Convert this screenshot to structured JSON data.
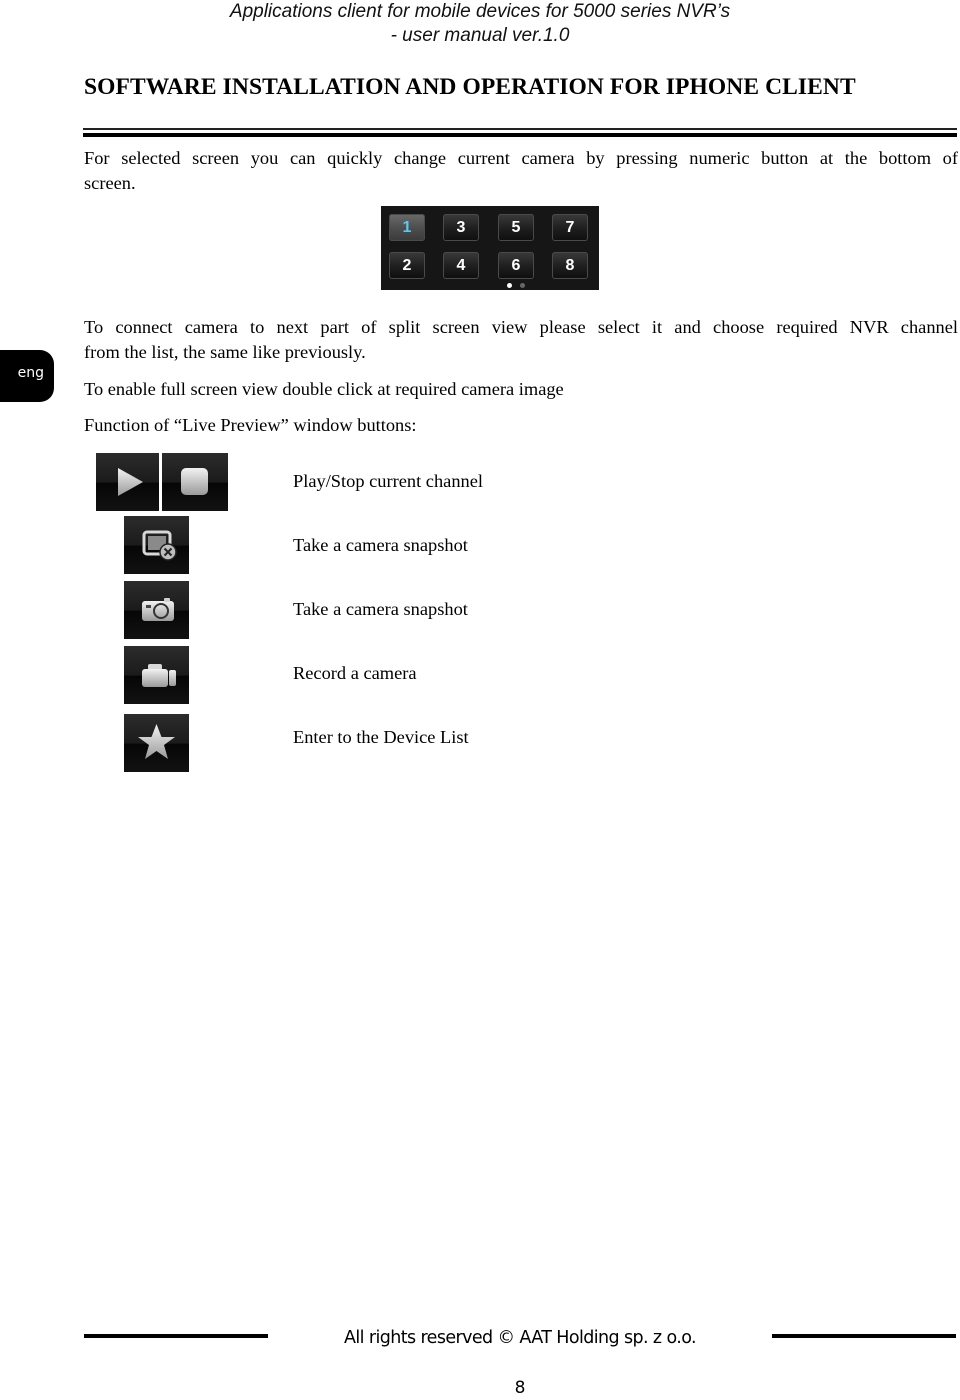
{
  "header": {
    "line1": "Applications client for mobile devices for 5000 series NVR’s",
    "line2": "- user manual ver.1.0"
  },
  "section_title": "SOFTWARE INSTALLATION AND OPERATION FOR IPHONE CLIENT",
  "side_tab": {
    "label": "eng"
  },
  "paragraphs": {
    "p1_line1": "For selected screen you can quickly change current camera by pressing numeric button at the bottom of",
    "p1_line2": "screen.",
    "p2_line1": "To connect camera to next part of split screen view please select it and choose required NVR channel",
    "p2_line2": "from the list, the same like previously.",
    "p3": "To enable full screen view double click at required camera image",
    "p4": "Function of “Live Preview” window buttons:"
  },
  "keypad": {
    "keys": [
      "1",
      "3",
      "5",
      "7",
      "2",
      "4",
      "6",
      "8"
    ],
    "active_key": "1",
    "active_color": "#5cc8f0",
    "page_indicator": {
      "pages": 2,
      "current": 1
    }
  },
  "functions": [
    {
      "icons": [
        "play-icon",
        "stop-icon"
      ],
      "label": "Play/Stop current channel"
    },
    {
      "icons": [
        "close-snapshot-icon"
      ],
      "label": "Take a camera snapshot"
    },
    {
      "icons": [
        "camera-icon"
      ],
      "label": "Take a camera snapshot"
    },
    {
      "icons": [
        "video-camera-icon"
      ],
      "label": "Record a camera"
    },
    {
      "icons": [
        "star-icon"
      ],
      "label": "Enter to the Device List"
    }
  ],
  "footer": {
    "copyright": "All rights reserved © AAT Holding sp. z o.o.",
    "page_number": "8"
  }
}
